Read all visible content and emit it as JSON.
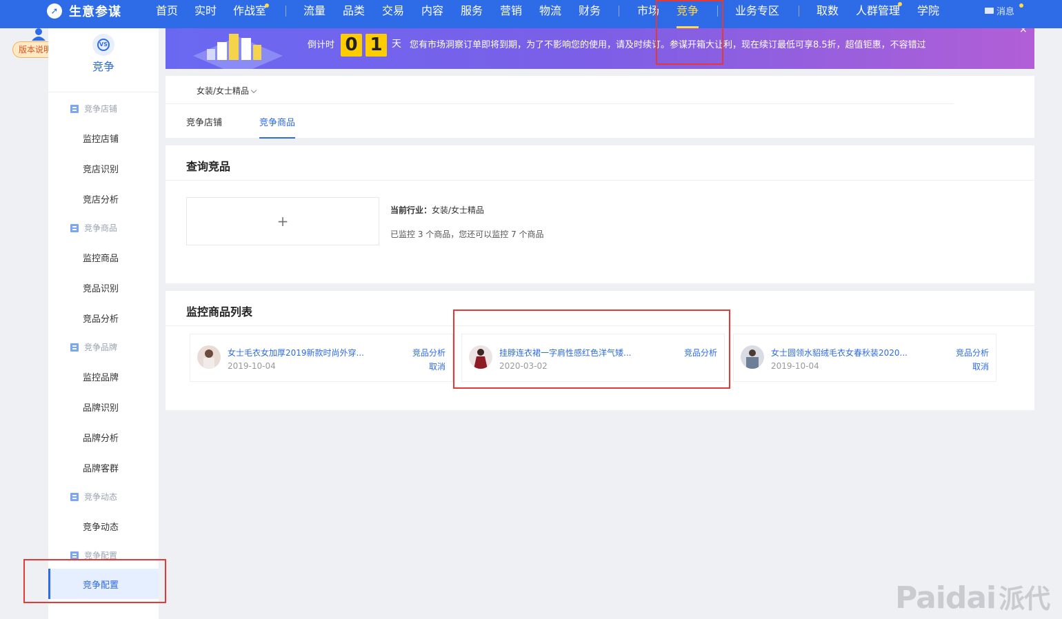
{
  "app": {
    "title": "生意参谋"
  },
  "nav": {
    "items": [
      "首页",
      "实时",
      "作战室",
      "流量",
      "品类",
      "交易",
      "内容",
      "服务",
      "营销",
      "物流",
      "财务",
      "市场",
      "竞争",
      "业务专区",
      "取数",
      "人群管理",
      "学院"
    ],
    "active": "竞争",
    "message": "消息"
  },
  "rail": {
    "version_badge": "版本说明"
  },
  "sidebar": {
    "title": "竞争",
    "groups": [
      "竞争店铺",
      "竞争商品",
      "竞争品牌",
      "竞争动态",
      "竞争配置"
    ],
    "items": [
      "监控店铺",
      "竞店识别",
      "竞店分析",
      "监控商品",
      "竞品识别",
      "竞品分析",
      "监控品牌",
      "品牌识别",
      "品牌分析",
      "品牌客群",
      "竞争动态"
    ],
    "active_item": "竞争配置"
  },
  "banner": {
    "countdown_label": "倒计时",
    "digits": [
      "0",
      "1"
    ],
    "unit": "天",
    "message": "您有市场洞察订单即将到期，为了不影响您的使用，请及时续订。参谋开箱大让利，现在续订最低可享8.5折，超值钜惠，不容错过",
    "close": "×"
  },
  "category": {
    "selected": "女装/女士精品",
    "tabs": [
      "竞争店铺",
      "竞争商品"
    ],
    "active_tab": "竞争商品"
  },
  "query": {
    "title": "查询竞品",
    "add_symbol": "+",
    "industry_label": "当前行业：",
    "industry_value": "女装/女士精品",
    "monitor_info": "已监控 3 个商品，您还可以监控 7 个商品"
  },
  "list": {
    "title": "监控商品列表",
    "products": [
      {
        "name": "女士毛衣女加厚2019新款时尚外穿...",
        "date": "2019-10-04",
        "analysis": "竞品分析",
        "cancel": "取消"
      },
      {
        "name": "挂脖连衣裙一字肩性感红色洋气矮...",
        "date": "2020-03-02",
        "analysis": "竞品分析",
        "cancel": ""
      },
      {
        "name": "女士圆领水貂绒毛衣女春秋装2020...",
        "date": "2019-10-04",
        "analysis": "竞品分析",
        "cancel": "取消"
      }
    ]
  },
  "watermark": {
    "latin": "Paidai",
    "cjk": "派代"
  },
  "colors": {
    "primary": "#2e6be6",
    "highlight": "#e53935",
    "active_nav": "#ffd94a"
  }
}
